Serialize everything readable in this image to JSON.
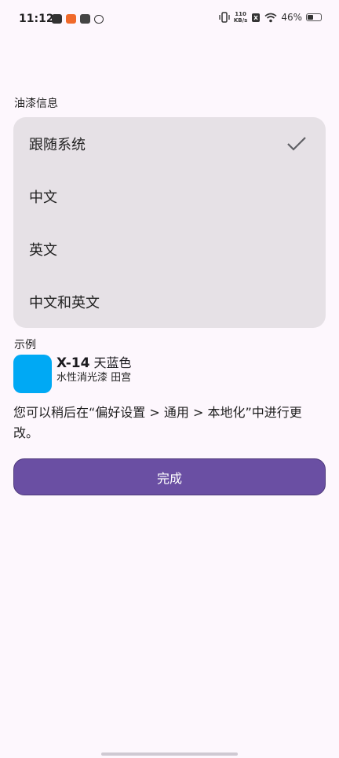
{
  "status_bar": {
    "time": "11:12",
    "net_speed_value": "110",
    "net_speed_unit": "KB/s",
    "battery_percent": "46%",
    "battery_level": 0.46,
    "notification_icons": [
      "mail-icon",
      "app-orange-icon",
      "app-badge-icon",
      "link-icon"
    ]
  },
  "section_title": "油漆信息",
  "options": [
    {
      "label": "跟随系统",
      "selected": true
    },
    {
      "label": "中文",
      "selected": false
    },
    {
      "label": "英文",
      "selected": false
    },
    {
      "label": "中文和英文",
      "selected": false
    }
  ],
  "example": {
    "label": "示例",
    "code": "X-14",
    "name": "天蓝色",
    "subtitle": "水性消光漆 田宫",
    "swatch_color": "#00a9f4"
  },
  "hint": "您可以稍后在“偏好设置 > 通用 > 本地化”中进行更改。",
  "done_label": "完成",
  "colors": {
    "accent": "#6a4fa3",
    "card": "#e6e1e6",
    "background": "#fdf7fd"
  }
}
